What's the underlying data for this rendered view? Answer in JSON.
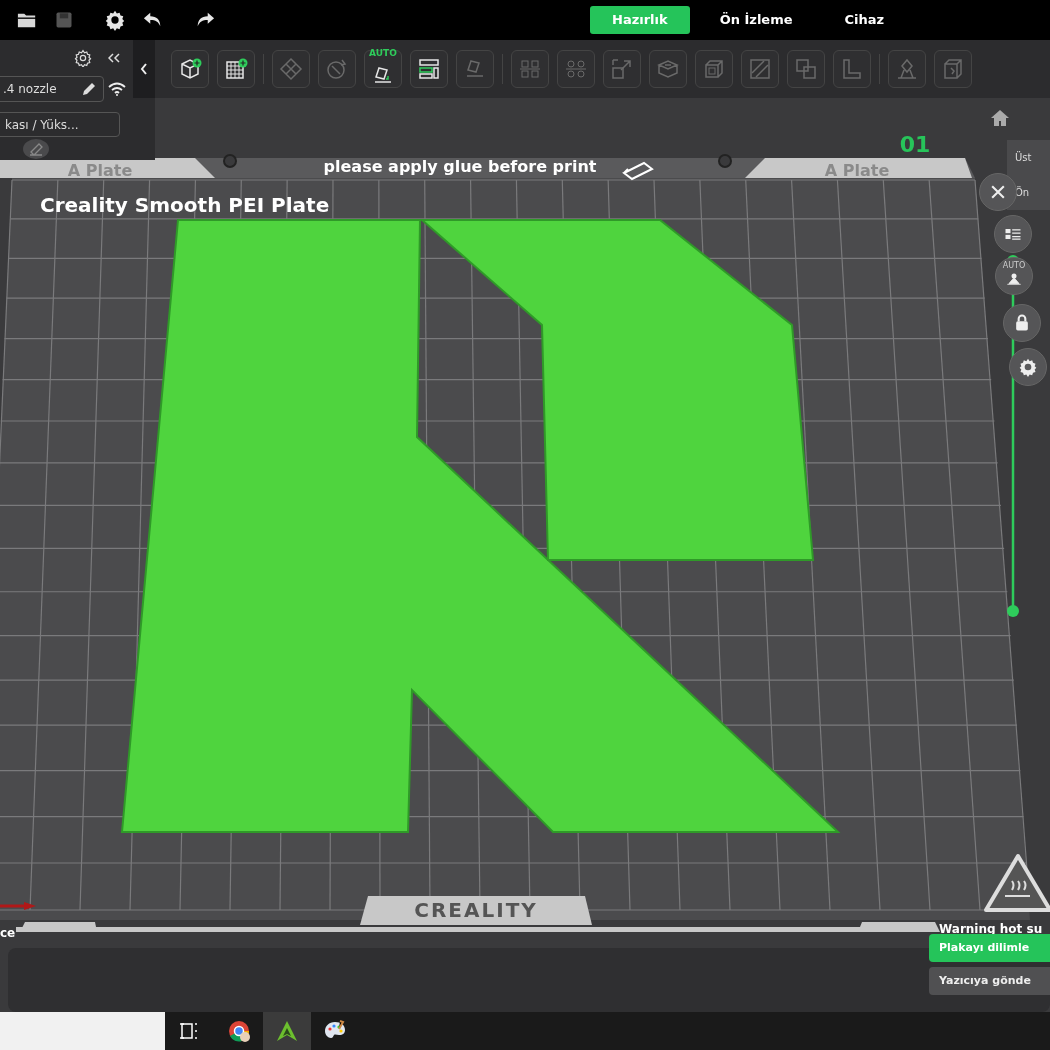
{
  "top_bar": {
    "tabs": [
      {
        "label": "Hazırlık",
        "selected": true
      },
      {
        "label": "Ön İzleme",
        "selected": false
      },
      {
        "label": "Cihaz",
        "selected": false
      }
    ]
  },
  "left_panel": {
    "nozzle": ".4 nozzle",
    "plate_type": "kası / Yüks..."
  },
  "toolbar": {
    "tools": [
      {
        "kind": "cube-plus",
        "disabled": false
      },
      {
        "kind": "grid-plus",
        "disabled": false
      },
      {
        "kind": "diamond",
        "disabled": true
      },
      {
        "kind": "circle-arrow",
        "disabled": true
      },
      {
        "kind": "auto-orient",
        "disabled": false,
        "label": "AUTO"
      },
      {
        "kind": "layout",
        "disabled": false
      },
      {
        "kind": "tilted",
        "disabled": true
      },
      {
        "kind": "four-squares",
        "disabled": true
      },
      {
        "kind": "four-circles",
        "disabled": true
      },
      {
        "kind": "scale",
        "disabled": true
      },
      {
        "kind": "stacked-box",
        "disabled": true
      },
      {
        "kind": "box",
        "disabled": true
      },
      {
        "kind": "hatched",
        "disabled": true
      },
      {
        "kind": "overlap",
        "disabled": true
      },
      {
        "kind": "l-shape",
        "disabled": true
      },
      {
        "kind": "figure",
        "disabled": true
      },
      {
        "kind": "cube",
        "disabled": true
      }
    ]
  },
  "plate": {
    "tab_labels": [
      "A Plate",
      "A Plate"
    ],
    "notice": "please apply glue before print",
    "plate_name": "Creality Smooth PEI Plate",
    "plate_number": "01",
    "brand": "CREALITY",
    "warning": "Warning hot su",
    "axis_label": "ce"
  },
  "view_menu": [
    "Üst",
    "Ön"
  ],
  "layer_slider": {
    "level": 1
  },
  "view_controls": [
    {
      "kind": "close"
    },
    {
      "kind": "list"
    },
    {
      "kind": "auto",
      "label": "AUTO"
    },
    {
      "kind": "lock"
    },
    {
      "kind": "gear"
    }
  ],
  "actions": [
    {
      "label": "Plakayı dilimle",
      "kind": "primary"
    },
    {
      "label": "Yazıcıya gönde",
      "kind": "secondary"
    }
  ]
}
